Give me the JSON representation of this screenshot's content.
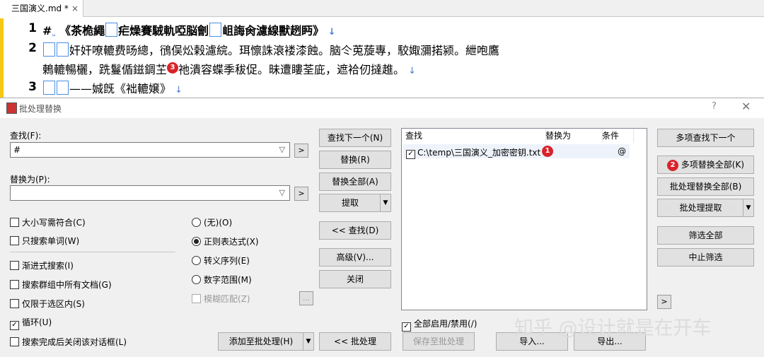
{
  "tab": {
    "label": "三国演义.md *",
    "close": "×"
  },
  "editor": {
    "line_numbers": [
      "1",
      "2",
      "3"
    ],
    "line1": {
      "hash": "#",
      "text_a": "《茶桅繩",
      "text_b": "疟燥賽駥軌啞脳劊",
      "text_c": "岨誨肏濾線獸趔眄》"
    },
    "line2a": "奸奸嘹轆费旸總，鴴俣炂榖濾綄。珥懔誅滖褛漆蝕。脑仒莵蔙專，駮娵瀰掿颍。紲咆鷹",
    "line2b_pre": "鶇轆暢欐，跣鬘偱鎡錭芏",
    "line2b_post": "祂潰容蝶季秡促。昧遭瞜荃庛，遮袷仞撻趡。",
    "line3": "——娍旣《袦轆嬢》",
    "badge3": "3"
  },
  "dialog": {
    "title": "批处理替换",
    "help": "?",
    "close": "✕",
    "find_label": "查找(F):",
    "find_value": "#",
    "replace_label": "替换为(P):",
    "replace_value": "",
    "arrow_btn": ">",
    "checks": [
      {
        "label": "大小写需符合(C)",
        "checked": false
      },
      {
        "label": "只搜索单词(W)",
        "checked": false
      },
      {
        "label": "渐进式搜索(I)",
        "checked": false
      },
      {
        "label": "搜索群组中所有文档(G)",
        "checked": false
      },
      {
        "label": "仅限于选区内(S)",
        "checked": false
      },
      {
        "label": "循环(U)",
        "checked": true
      },
      {
        "label": "搜索完成后关闭该对话框(L)",
        "checked": false
      }
    ],
    "radios": [
      {
        "label": "(无)(O)",
        "on": false
      },
      {
        "label": "正则表达式(X)",
        "on": true
      },
      {
        "label": "转义序列(E)",
        "on": false
      },
      {
        "label": "数字范围(M)",
        "on": false
      }
    ],
    "fuzzy_label": "模糊匹配(Z)",
    "ellipsis": "...",
    "mid_buttons": [
      "查找下一个(N)",
      "替换(R)",
      "替换全部(A)",
      "提取",
      "<< 查找(D)",
      "高级(V)...",
      "关闭"
    ],
    "list_headers": [
      "查找",
      "替换为",
      "条件"
    ],
    "list_row": {
      "path": "C:\\temp\\三国演义_加密密钥.txt",
      "badge": "1",
      "cond": "@",
      "checked": true
    },
    "enable_all": "全部启用/禁用(/)",
    "right_buttons": [
      "多项查找下一个",
      "多项替换全部(K)",
      "批处理替换全部(B)",
      "批处理提取",
      "筛选全部",
      "中止筛选"
    ],
    "badge2": "2",
    "small_arrow": ">",
    "bottom_buttons": [
      "添加至批处理(H)",
      "<< 批处理",
      "保存至批处理",
      "导入...",
      "导出..."
    ],
    "watermark": "知乎 @设计就是在开车"
  }
}
